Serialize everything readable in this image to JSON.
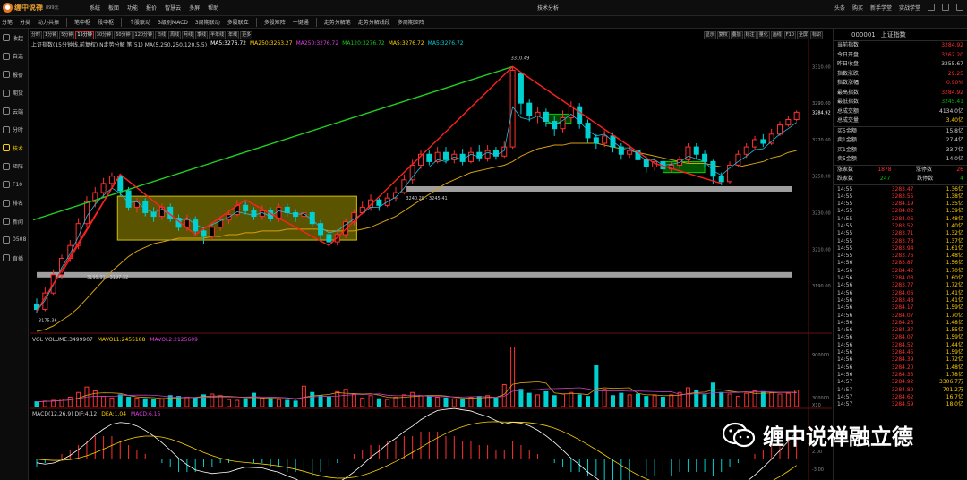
{
  "app": {
    "name": "缠中说禅",
    "price": "899元",
    "window_title": "技术分析",
    "logo_icon": "flame-icon"
  },
  "menus": [
    "系统",
    "板面",
    "功能",
    "报价",
    "智慧云",
    "多屏",
    "帮助"
  ],
  "right_menus": [
    "头条",
    "购买",
    "新手学堂",
    "实战学堂"
  ],
  "toolbar": [
    "分笔",
    "分类",
    "动力共振",
    "笔中枢",
    "段中枢",
    "个股联动",
    "3级别MACD",
    "3周期联动",
    "多股联立",
    "多股矩阵",
    "一键通",
    "走势分解笔",
    "走势分解线段",
    "多周期矩阵"
  ],
  "sidebar": [
    {
      "label": "收起",
      "icon": "collapse-icon"
    },
    {
      "label": "自选",
      "icon": "star-icon"
    },
    {
      "label": "报价",
      "icon": "quote-icon"
    },
    {
      "label": "期货",
      "icon": "futures-icon"
    },
    {
      "label": "云端",
      "icon": "cloud-icon"
    },
    {
      "label": "分时",
      "icon": "clock-icon"
    },
    {
      "label": "技术",
      "icon": "candle-icon"
    },
    {
      "label": "矩阵",
      "icon": "grid-icon"
    },
    {
      "label": "F10",
      "icon": "doc-icon"
    },
    {
      "label": "排名",
      "icon": "rank-icon"
    },
    {
      "label": "新闻",
      "icon": "news-icon"
    },
    {
      "label": "0508",
      "icon": "market-icon"
    },
    {
      "label": "直播",
      "icon": "live-icon"
    }
  ],
  "active_sidebar": "技术",
  "periods": [
    "分时",
    "1分钟",
    "5分钟",
    "15分钟",
    "30分钟",
    "60分钟",
    "120分钟",
    "日线",
    "周线",
    "月线",
    "季线",
    "半年线",
    "年线",
    "更多"
  ],
  "active_period": "15分钟",
  "right_tools": [
    "显示",
    "复权",
    "叠加",
    "标注",
    "量化",
    "画线",
    "F10",
    "全屏",
    "标识"
  ],
  "chart_info": {
    "title": "上证指数(15分钟线,前复权) N走势分解 笔(51) MA(5,250,250,120,5,5)",
    "ma5a": "MA5:3276.72",
    "ma250": "MA250:3263.27",
    "ma250b": "MA250:3276.72",
    "ma120": "MA120:3276.72",
    "ma5b": "MA5:3276.72",
    "ma5c": "MA5:3276.72"
  },
  "vol_info": {
    "vol": "VOL VOLUME:3499907",
    "mavol1": "MAVOL1:2455188",
    "mavol2": "MAVOL2:2125609"
  },
  "macd_info": {
    "label": "MACD(12,26,9) DIF:4.12",
    "dea": "DEA:1.04",
    "macd": "MACD:6.15"
  },
  "labels": {
    "high": "3310.49",
    "low": "3175.36",
    "band1": "3195.31 - 3197.32",
    "band2": "3240.28 - 3245.41",
    "cur_price": "3284.92",
    "x10": "X10"
  },
  "y_axis": [
    "3310.00",
    "3290.00",
    "3270.00",
    "3250.00",
    "3230.00",
    "3210.00",
    "3190.00"
  ],
  "vol_axis": [
    "900000",
    "300000"
  ],
  "macd_axis": [
    "2.00",
    "-3.00"
  ],
  "colors": {
    "up": "#ff3030",
    "down": "#00d0d0",
    "ma_green": "#18c818",
    "ma_yellow": "#d4a010",
    "bg": "#000000"
  },
  "quote": {
    "code": "000001",
    "name": "上证指数",
    "rows": [
      {
        "k": "当前指数",
        "v": "3284.92",
        "c": "up"
      },
      {
        "k": "今日开盘",
        "v": "3262.20",
        "c": "up"
      },
      {
        "k": "昨日收盘",
        "v": "3255.67",
        "c": "wt"
      },
      {
        "k": "指数涨跌",
        "v": "29.25",
        "c": "up"
      },
      {
        "k": "指数涨幅",
        "v": "0.90%",
        "c": "up"
      },
      {
        "k": "最高指数",
        "v": "3284.92",
        "c": "up"
      },
      {
        "k": "最低指数",
        "v": "3245.41",
        "c": "gr"
      },
      {
        "k": "总成交额",
        "v": "4134.0亿",
        "c": "wt"
      },
      {
        "k": "总成交量",
        "v": "3.40亿",
        "c": "yl"
      }
    ],
    "rows2": [
      {
        "k": "买5金额",
        "v": "15.8亿",
        "c": "wt"
      },
      {
        "k": "卖1金额",
        "v": "27.4亿",
        "c": "wt"
      },
      {
        "k": "买1金额",
        "v": "33.7亿",
        "c": "wt"
      },
      {
        "k": "卖5金额",
        "v": "14.0亿",
        "c": "wt"
      }
    ],
    "breadth": [
      {
        "k": "涨家数",
        "v": "1878",
        "c": "up",
        "k2": "涨停数",
        "v2": "26",
        "c2": "up"
      },
      {
        "k": "跌家数",
        "v": "247",
        "c": "gr",
        "k2": "跌停数",
        "v2": "4",
        "c2": "gr"
      }
    ],
    "ticks": [
      {
        "t": "14:55",
        "p": "3283.47",
        "v": "1.36亿"
      },
      {
        "t": "14:55",
        "p": "3283.55",
        "v": "1.38亿"
      },
      {
        "t": "14:55",
        "p": "3284.19",
        "v": "1.35亿"
      },
      {
        "t": "14:55",
        "p": "3284.02",
        "v": "1.39亿"
      },
      {
        "t": "14:55",
        "p": "3284.06",
        "v": "1.48亿"
      },
      {
        "t": "14:55",
        "p": "3283.52",
        "v": "1.40亿"
      },
      {
        "t": "14:55",
        "p": "3283.71",
        "v": "1.32亿"
      },
      {
        "t": "14:55",
        "p": "3283.78",
        "v": "1.37亿"
      },
      {
        "t": "14:55",
        "p": "3283.94",
        "v": "1.61亿"
      },
      {
        "t": "14:55",
        "p": "3283.76",
        "v": "1.48亿"
      },
      {
        "t": "14:56",
        "p": "3283.87",
        "v": "1.56亿"
      },
      {
        "t": "14:56",
        "p": "3284.42",
        "v": "1.70亿"
      },
      {
        "t": "14:56",
        "p": "3284.03",
        "v": "1.60亿"
      },
      {
        "t": "14:56",
        "p": "3283.77",
        "v": "1.72亿"
      },
      {
        "t": "14:56",
        "p": "3284.06",
        "v": "1.41亿"
      },
      {
        "t": "14:56",
        "p": "3283.48",
        "v": "1.41亿"
      },
      {
        "t": "14:56",
        "p": "3284.17",
        "v": "1.59亿"
      },
      {
        "t": "14:56",
        "p": "3284.07",
        "v": "1.70亿"
      },
      {
        "t": "14:56",
        "p": "3284.25",
        "v": "1.48亿"
      },
      {
        "t": "14:56",
        "p": "3284.37",
        "v": "1.55亿"
      },
      {
        "t": "14:56",
        "p": "3284.07",
        "v": "1.59亿"
      },
      {
        "t": "14:56",
        "p": "3284.52",
        "v": "1.44亿"
      },
      {
        "t": "14:56",
        "p": "3284.45",
        "v": "1.59亿"
      },
      {
        "t": "14:56",
        "p": "3284.39",
        "v": "1.72亿"
      },
      {
        "t": "14:56",
        "p": "3284.20",
        "v": "1.48亿"
      },
      {
        "t": "14:56",
        "p": "3284.33",
        "v": "1.78亿"
      },
      {
        "t": "14:57",
        "p": "3284.92",
        "v": "3306.7万"
      },
      {
        "t": "14:57",
        "p": "3284.89",
        "v": "701.2万"
      },
      {
        "t": "14:57",
        "p": "3284.62",
        "v": "16.7亿"
      },
      {
        "t": "14:57",
        "p": "3284.59",
        "v": "18.0亿"
      }
    ]
  },
  "watermark": {
    "text": "缠中说禅融立德",
    "icon": "wechat-icon"
  },
  "chart_data": {
    "type": "candlestick",
    "title": "上证指数(15分钟线,前复权)",
    "y_range": [
      3165,
      3320
    ],
    "high": 3310.49,
    "low": 3175.36,
    "candles": [
      [
        3180,
        3177,
        3183,
        3175
      ],
      [
        3177,
        3186,
        3189,
        3176
      ],
      [
        3186,
        3196,
        3199,
        3185
      ],
      [
        3196,
        3205,
        3207,
        3194
      ],
      [
        3205,
        3212,
        3215,
        3203
      ],
      [
        3212,
        3224,
        3227,
        3210
      ],
      [
        3224,
        3236,
        3239,
        3222
      ],
      [
        3236,
        3241,
        3244,
        3233
      ],
      [
        3241,
        3246,
        3249,
        3238
      ],
      [
        3246,
        3250,
        3252,
        3243
      ],
      [
        3250,
        3242,
        3251,
        3239
      ],
      [
        3242,
        3233,
        3244,
        3231
      ],
      [
        3233,
        3236,
        3238,
        3230
      ],
      [
        3236,
        3230,
        3238,
        3228
      ],
      [
        3230,
        3228,
        3233,
        3225
      ],
      [
        3228,
        3233,
        3235,
        3226
      ],
      [
        3233,
        3227,
        3235,
        3225
      ],
      [
        3227,
        3222,
        3229,
        3220
      ],
      [
        3222,
        3226,
        3229,
        3220
      ],
      [
        3226,
        3220,
        3228,
        3217
      ],
      [
        3220,
        3217,
        3222,
        3213
      ],
      [
        3217,
        3222,
        3224,
        3215
      ],
      [
        3222,
        3226,
        3228,
        3220
      ],
      [
        3226,
        3229,
        3231,
        3224
      ],
      [
        3229,
        3234,
        3237,
        3228
      ],
      [
        3234,
        3231,
        3236,
        3229
      ],
      [
        3231,
        3228,
        3233,
        3226
      ],
      [
        3228,
        3231,
        3234,
        3226
      ],
      [
        3231,
        3227,
        3233,
        3225
      ],
      [
        3227,
        3233,
        3235,
        3225
      ],
      [
        3233,
        3230,
        3235,
        3228
      ],
      [
        3230,
        3228,
        3232,
        3225
      ],
      [
        3228,
        3230,
        3233,
        3226
      ],
      [
        3230,
        3224,
        3231,
        3222
      ],
      [
        3224,
        3218,
        3226,
        3214
      ],
      [
        3218,
        3214,
        3220,
        3211
      ],
      [
        3214,
        3218,
        3221,
        3212
      ],
      [
        3218,
        3225,
        3227,
        3216
      ],
      [
        3225,
        3230,
        3232,
        3223
      ],
      [
        3230,
        3233,
        3236,
        3229
      ],
      [
        3233,
        3237,
        3240,
        3231
      ],
      [
        3237,
        3234,
        3238,
        3231
      ],
      [
        3234,
        3238,
        3241,
        3233
      ],
      [
        3238,
        3241,
        3244,
        3236
      ],
      [
        3241,
        3248,
        3251,
        3240
      ],
      [
        3248,
        3256,
        3259,
        3246
      ],
      [
        3256,
        3262,
        3264,
        3254
      ],
      [
        3262,
        3258,
        3264,
        3256
      ],
      [
        3258,
        3263,
        3266,
        3257
      ],
      [
        3263,
        3259,
        3266,
        3257
      ],
      [
        3259,
        3262,
        3264,
        3257
      ],
      [
        3262,
        3258,
        3265,
        3256
      ],
      [
        3258,
        3263,
        3266,
        3257
      ],
      [
        3263,
        3260,
        3267,
        3258
      ],
      [
        3260,
        3264,
        3267,
        3258
      ],
      [
        3264,
        3261,
        3266,
        3259
      ],
      [
        3261,
        3266,
        3269,
        3260
      ],
      [
        3266,
        3308,
        3310,
        3265
      ],
      [
        3306,
        3290,
        3307,
        3284
      ],
      [
        3290,
        3283,
        3292,
        3280
      ],
      [
        3283,
        3285,
        3288,
        3279
      ],
      [
        3285,
        3280,
        3287,
        3277
      ],
      [
        3280,
        3276,
        3283,
        3272
      ],
      [
        3276,
        3282,
        3286,
        3274
      ],
      [
        3282,
        3288,
        3291,
        3280
      ],
      [
        3288,
        3279,
        3290,
        3276
      ],
      [
        3279,
        3271,
        3281,
        3268
      ],
      [
        3271,
        3268,
        3273,
        3265
      ],
      [
        3268,
        3272,
        3275,
        3266
      ],
      [
        3272,
        3266,
        3274,
        3263
      ],
      [
        3266,
        3262,
        3268,
        3259
      ],
      [
        3262,
        3264,
        3267,
        3260
      ],
      [
        3264,
        3259,
        3266,
        3256
      ],
      [
        3259,
        3255,
        3261,
        3252
      ],
      [
        3255,
        3258,
        3260,
        3253
      ],
      [
        3258,
        3254,
        3260,
        3252
      ],
      [
        3254,
        3256,
        3258,
        3252
      ],
      [
        3256,
        3259,
        3261,
        3254
      ],
      [
        3259,
        3266,
        3268,
        3257
      ],
      [
        3266,
        3262,
        3268,
        3259
      ],
      [
        3262,
        3258,
        3264,
        3255
      ],
      [
        3258,
        3250,
        3259,
        3246
      ],
      [
        3250,
        3247,
        3252,
        3245
      ],
      [
        3247,
        3256,
        3258,
        3246
      ],
      [
        3256,
        3262,
        3264,
        3255
      ],
      [
        3262,
        3266,
        3268,
        3260
      ],
      [
        3266,
        3270,
        3272,
        3264
      ],
      [
        3270,
        3268,
        3273,
        3266
      ],
      [
        3268,
        3273,
        3276,
        3267
      ],
      [
        3273,
        3278,
        3280,
        3272
      ],
      [
        3278,
        3281,
        3283,
        3277
      ],
      [
        3281,
        3285,
        3286,
        3280
      ]
    ],
    "bi_points": [
      [
        0,
        3176
      ],
      [
        10,
        3251
      ],
      [
        19,
        3218
      ],
      [
        25,
        3237
      ],
      [
        35,
        3212
      ],
      [
        57,
        3310
      ],
      [
        74,
        3257
      ],
      [
        82,
        3246
      ]
    ],
    "segment": [
      [
        0,
        3226
      ],
      [
        57,
        3310
      ]
    ],
    "zhongshu": [
      {
        "from": 10,
        "to": 38,
        "top": 3239,
        "bottom": 3215
      }
    ],
    "bands": [
      {
        "price": 3196,
        "label": "3195.31 - 3197.32"
      },
      {
        "price": 3243,
        "label": "3240.28 - 3245.41"
      }
    ],
    "ma_green": [
      3175,
      3178,
      3185,
      3195,
      3203,
      3210,
      3220,
      3228,
      3233,
      3237,
      3239,
      3238,
      3236,
      3234,
      3232,
      3231,
      3230,
      3229,
      3228,
      3227,
      3226,
      3225,
      3225,
      3226,
      3227,
      3228,
      3229,
      3229,
      3229,
      3229,
      3230,
      3230,
      3229,
      3228,
      3226,
      3224,
      3222,
      3222,
      3223,
      3226,
      3229,
      3232,
      3234,
      3236,
      3239,
      3243,
      3248,
      3252,
      3255,
      3257,
      3259,
      3260,
      3261,
      3261,
      3262,
      3262,
      3262,
      3268,
      3274,
      3279,
      3281,
      3281,
      3280,
      3279,
      3280,
      3281,
      3279,
      3276,
      3274,
      3272,
      3269,
      3267,
      3265,
      3262,
      3260,
      3258,
      3257,
      3256,
      3256,
      3257,
      3258,
      3256,
      3254,
      3253,
      3254,
      3256,
      3259,
      3262,
      3265,
      3268,
      3271,
      3274
    ],
    "ma_yellow": [
      3165,
      3166,
      3168,
      3171,
      3174,
      3178,
      3183,
      3188,
      3193,
      3198,
      3202,
      3206,
      3209,
      3211,
      3213,
      3214,
      3215,
      3216,
      3216,
      3216,
      3216,
      3217,
      3217,
      3218,
      3218,
      3219,
      3219,
      3220,
      3220,
      3220,
      3221,
      3221,
      3221,
      3221,
      3221,
      3220,
      3220,
      3220,
      3220,
      3221,
      3222,
      3224,
      3226,
      3228,
      3231,
      3234,
      3237,
      3240,
      3243,
      3246,
      3248,
      3250,
      3252,
      3253,
      3254,
      3255,
      3256,
      3258,
      3261,
      3263,
      3265,
      3266,
      3267,
      3267,
      3268,
      3268,
      3268,
      3268,
      3267,
      3266,
      3265,
      3264,
      3263,
      3262,
      3261,
      3260,
      3259,
      3258,
      3257,
      3257,
      3257,
      3256,
      3255,
      3255,
      3255,
      3256,
      3257,
      3258,
      3260,
      3261,
      3263,
      3264
    ],
    "volume": [
      62,
      70,
      80,
      95,
      120,
      180,
      250,
      200,
      130,
      110,
      150,
      120,
      110,
      100,
      90,
      95,
      140,
      130,
      120,
      110,
      150,
      160,
      140,
      90,
      80,
      100,
      170,
      110,
      100,
      90,
      80,
      70,
      260,
      180,
      140,
      120,
      190,
      220,
      160,
      110,
      140,
      100,
      90,
      120,
      150,
      180,
      140,
      130,
      120,
      110,
      100,
      90,
      120,
      130,
      140,
      110,
      280,
      760,
      220,
      170,
      150,
      190,
      140,
      160,
      180,
      150,
      130,
      520,
      220,
      140,
      170,
      150,
      160,
      130,
      140,
      120,
      150,
      180,
      240,
      200,
      150,
      300,
      180,
      160,
      130,
      170,
      200,
      190,
      180,
      160,
      170,
      210
    ],
    "macd": [
      -2,
      -1,
      0,
      1,
      2,
      3,
      4,
      5,
      5,
      5,
      4,
      3,
      2,
      1,
      0,
      -1,
      -2,
      -3,
      -3,
      -3,
      -2,
      -2,
      -1,
      -1,
      0,
      0,
      -1,
      -1,
      -2,
      -2,
      -3,
      -3,
      -4,
      -4,
      -3,
      -2,
      -1,
      0,
      1,
      2,
      3,
      3,
      4,
      4,
      5,
      5,
      6,
      6,
      6,
      5,
      5,
      4,
      4,
      3,
      3,
      2,
      2,
      4,
      3,
      2,
      1,
      0,
      -1,
      -2,
      -3,
      -3,
      -4,
      -4,
      -5,
      -5,
      -5,
      -5,
      -5,
      -4,
      -4,
      -4,
      -4,
      -3,
      -3,
      -3,
      -3,
      -4,
      -3,
      -2,
      -1,
      0,
      1,
      2,
      3,
      4,
      5,
      6
    ]
  }
}
